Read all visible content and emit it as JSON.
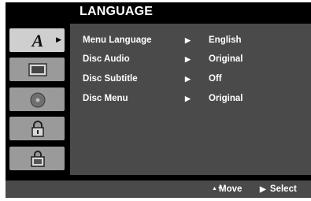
{
  "title": "LANGUAGE",
  "sidebar": {
    "items": [
      {
        "icon": "language-icon",
        "active": true
      },
      {
        "icon": "display-icon",
        "active": false
      },
      {
        "icon": "audio-disc-icon",
        "active": false
      },
      {
        "icon": "lock-icon",
        "active": false
      },
      {
        "icon": "others-icon",
        "active": false
      }
    ]
  },
  "menu": {
    "rows": [
      {
        "label": "Menu Language",
        "arrow": "▶",
        "value": "English"
      },
      {
        "label": "Disc Audio",
        "arrow": "▶",
        "value": "Original"
      },
      {
        "label": "Disc Subtitle",
        "arrow": "▶",
        "value": "Off"
      },
      {
        "label": "Disc Menu",
        "arrow": "▶",
        "value": "Original"
      }
    ]
  },
  "footer": {
    "move_glyph": "▲▼",
    "move_label": "Move",
    "select_glyph": "▶",
    "select_label": "Select"
  },
  "colors": {
    "panel": "#4a4a4a",
    "background": "#000000",
    "text": "#ffffff"
  }
}
